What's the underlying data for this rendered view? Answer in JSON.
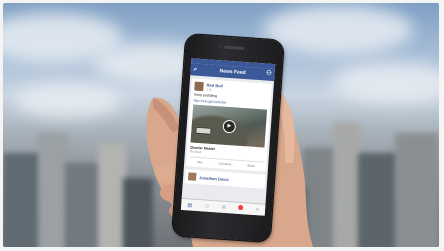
{
  "phone": {
    "screen": {
      "title": "News Feed",
      "post": {
        "author": "Red Bull",
        "time": "1 hr",
        "text": "Keep pedalling",
        "link": "http://win.gs/1ahGfox",
        "video_title": "Quarter Master",
        "video_subtitle": "Red Bull",
        "actions": [
          "Like",
          "Comment",
          "Share"
        ]
      },
      "next_post": {
        "author": "Jonathan Davis"
      }
    }
  },
  "icons": {
    "search": "search-icon",
    "friends": "friends-icon",
    "play": "play-icon"
  },
  "colors": {
    "facebook_blue": "#3b5998",
    "notification_red": "#fa3e3e"
  }
}
